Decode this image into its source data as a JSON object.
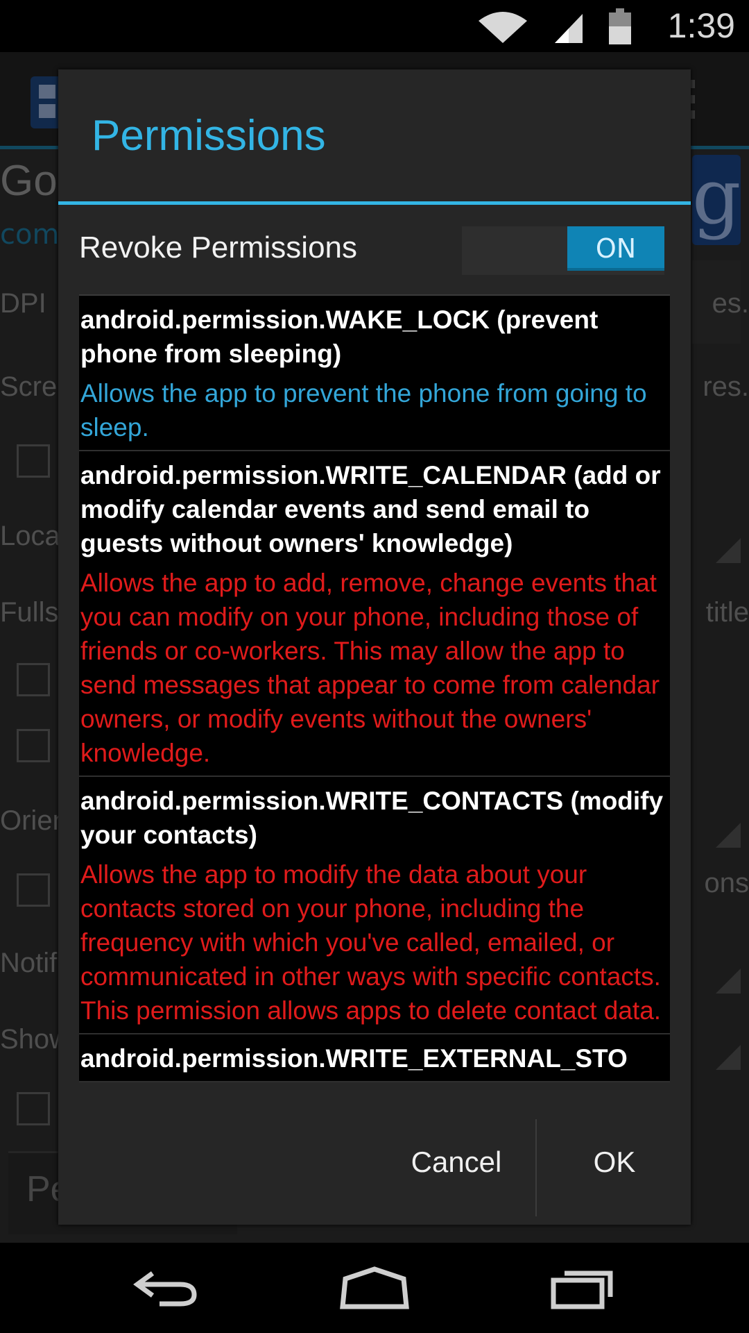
{
  "status_bar": {
    "time": "1:39",
    "icons": [
      "wifi-icon",
      "signal-icon",
      "battery-icon"
    ]
  },
  "background_app": {
    "title_fragment": "Go",
    "subtitle_fragment": "com",
    "labels_left": [
      "DPI",
      "Scre",
      "Loca",
      "Fulls",
      "Orien",
      "Notif",
      "Show"
    ],
    "labels_right": [
      "es.",
      "res.",
      "title",
      "ons"
    ],
    "bottom_box_fragment": "Pe",
    "logo_letter": "g"
  },
  "dialog": {
    "title": "Permissions",
    "revoke_label": "Revoke Permissions",
    "toggle_state": "ON",
    "permissions": [
      {
        "name": "android.permission.WAKE_LOCK (prevent phone from sleeping)",
        "description": "Allows the app to prevent the phone from going to sleep.",
        "level": "safe"
      },
      {
        "name": "android.permission.WRITE_CALENDAR (add or modify calendar events and send email to guests without owners' knowledge)",
        "description": "Allows the app to add, remove, change events that you can modify on your phone, including those of friends or co-workers. This may allow the app to send messages that appear to come from calendar owners, or modify events without the owners' knowledge.",
        "level": "danger"
      },
      {
        "name": "android.permission.WRITE_CONTACTS (modify your contacts)",
        "description": "Allows the app to modify the data about your contacts stored on your phone, including the frequency with which you've called, emailed, or communicated in other ways with specific contacts. This permission allows apps to delete contact data.",
        "level": "danger"
      },
      {
        "name": "android.permission.WRITE_EXTERNAL_STO",
        "description": "",
        "level": "safe"
      }
    ],
    "cancel_label": "Cancel",
    "ok_label": "OK"
  },
  "colors": {
    "accent": "#33b5e5",
    "safe_text": "#33a6d8",
    "danger_text": "#e01b1b",
    "toggle_on": "#0f84b5"
  },
  "nav_bar": {
    "icons": [
      "back-icon",
      "home-icon",
      "recents-icon"
    ]
  }
}
